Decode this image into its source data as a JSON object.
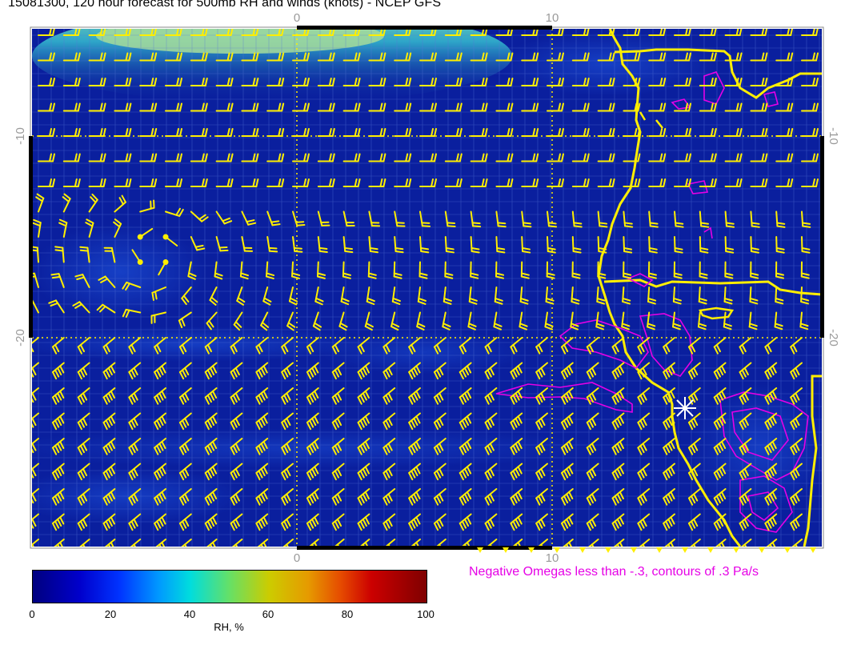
{
  "title": "15081300, 120 hour forecast for 500mb RH and winds (knots) - NCEP GFS",
  "axes": {
    "top_ticks": [
      "0",
      "10"
    ],
    "bottom_ticks": [
      "0",
      "10"
    ],
    "left_ticks": [
      "-10",
      "-20"
    ],
    "right_ticks": [
      "-10",
      "-20"
    ]
  },
  "omega_note": "Negative Omegas less than -.3, contours of .3 Pa/s",
  "colorbar": {
    "label": "RH, %",
    "ticks": [
      "0",
      "20",
      "40",
      "60",
      "80",
      "100"
    ],
    "range": [
      0,
      100
    ]
  },
  "colors": {
    "ocean": "#0a1f9e",
    "coast_and_barbs": "#ffee00",
    "omega_contours": "#e600e6",
    "marker": "#ffffff"
  },
  "icons": [
    "wind-barb-icon",
    "station-marker-icon"
  ]
}
